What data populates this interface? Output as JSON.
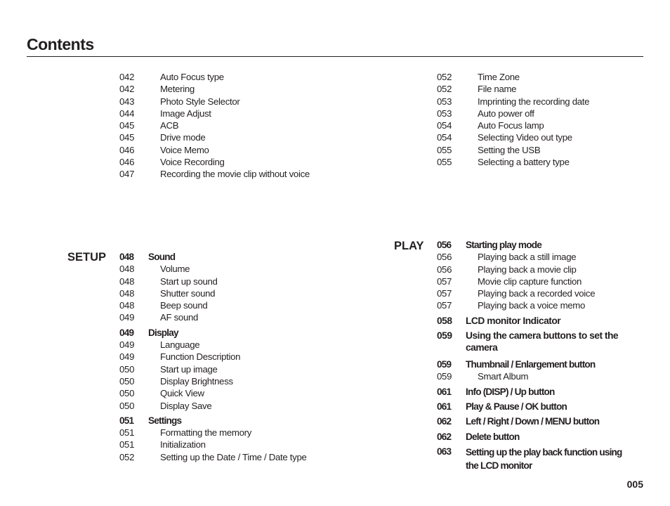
{
  "title": "Contents",
  "page_number": "005",
  "top_left": [
    {
      "page": "042",
      "label": "Auto Focus type"
    },
    {
      "page": "042",
      "label": "Metering"
    },
    {
      "page": "043",
      "label": "Photo Style Selector"
    },
    {
      "page": "044",
      "label": "Image Adjust"
    },
    {
      "page": "045",
      "label": "ACB"
    },
    {
      "page": "045",
      "label": "Drive mode"
    },
    {
      "page": "046",
      "label": "Voice Memo"
    },
    {
      "page": "046",
      "label": "Voice Recording"
    },
    {
      "page": "047",
      "label": "Recording the movie clip without voice"
    }
  ],
  "top_right": [
    {
      "page": "052",
      "label": "Time Zone"
    },
    {
      "page": "052",
      "label": "File name"
    },
    {
      "page": "053",
      "label": "Imprinting the recording date"
    },
    {
      "page": "053",
      "label": "Auto power off"
    },
    {
      "page": "054",
      "label": "Auto Focus lamp"
    },
    {
      "page": "054",
      "label": "Selecting Video out type"
    },
    {
      "page": "055",
      "label": "Setting the USB"
    },
    {
      "page": "055",
      "label": "Selecting a battery type"
    }
  ],
  "setup": {
    "heading": "SETUP",
    "entries": [
      {
        "page": "048",
        "label": "Sound",
        "type": "head"
      },
      {
        "page": "048",
        "label": "Volume"
      },
      {
        "page": "048",
        "label": "Start up sound"
      },
      {
        "page": "048",
        "label": "Shutter sound"
      },
      {
        "page": "048",
        "label": "Beep sound"
      },
      {
        "page": "049",
        "label": "AF sound"
      },
      {
        "page": "049",
        "label": "Display",
        "type": "head"
      },
      {
        "page": "049",
        "label": "Language"
      },
      {
        "page": "049",
        "label": "Function Description"
      },
      {
        "page": "050",
        "label": "Start up image"
      },
      {
        "page": "050",
        "label": "Display Brightness"
      },
      {
        "page": "050",
        "label": "Quick View"
      },
      {
        "page": "050",
        "label": "Display Save"
      },
      {
        "page": "051",
        "label": "Settings",
        "type": "head"
      },
      {
        "page": "051",
        "label": "Formatting the memory"
      },
      {
        "page": "051",
        "label": "Initialization"
      },
      {
        "page": "052",
        "label": "Setting up the Date / Time / Date type"
      }
    ]
  },
  "play": {
    "heading": "PLAY",
    "entries": [
      {
        "page": "056",
        "label": "Starting play mode",
        "type": "head"
      },
      {
        "page": "056",
        "label": "Playing back a still image"
      },
      {
        "page": "056",
        "label": "Playing back a movie clip"
      },
      {
        "page": "057",
        "label": "Movie clip capture function"
      },
      {
        "page": "057",
        "label": "Playing back a recorded voice"
      },
      {
        "page": "057",
        "label": "Playing back a voice memo"
      },
      {
        "page": "058",
        "label": "LCD monitor Indicator",
        "type": "big"
      },
      {
        "page": "059",
        "label": "Using the camera buttons to set the camera",
        "type": "big2"
      },
      {
        "page": "059",
        "label": "Thumbnail / Enlargement button",
        "type": "head"
      },
      {
        "page": "059",
        "label": "Smart Album"
      },
      {
        "page": "061",
        "label": "Info (DISP) / Up button",
        "type": "head"
      },
      {
        "page": "061",
        "label": "Play & Pause / OK button",
        "type": "head"
      },
      {
        "page": "062",
        "label": "Left / Right / Down / MENU button",
        "type": "head"
      },
      {
        "page": "062",
        "label": "Delete button",
        "type": "head"
      },
      {
        "page": "063",
        "label": "Setting up the play back function using the LCD monitor",
        "type": "head2"
      }
    ]
  }
}
